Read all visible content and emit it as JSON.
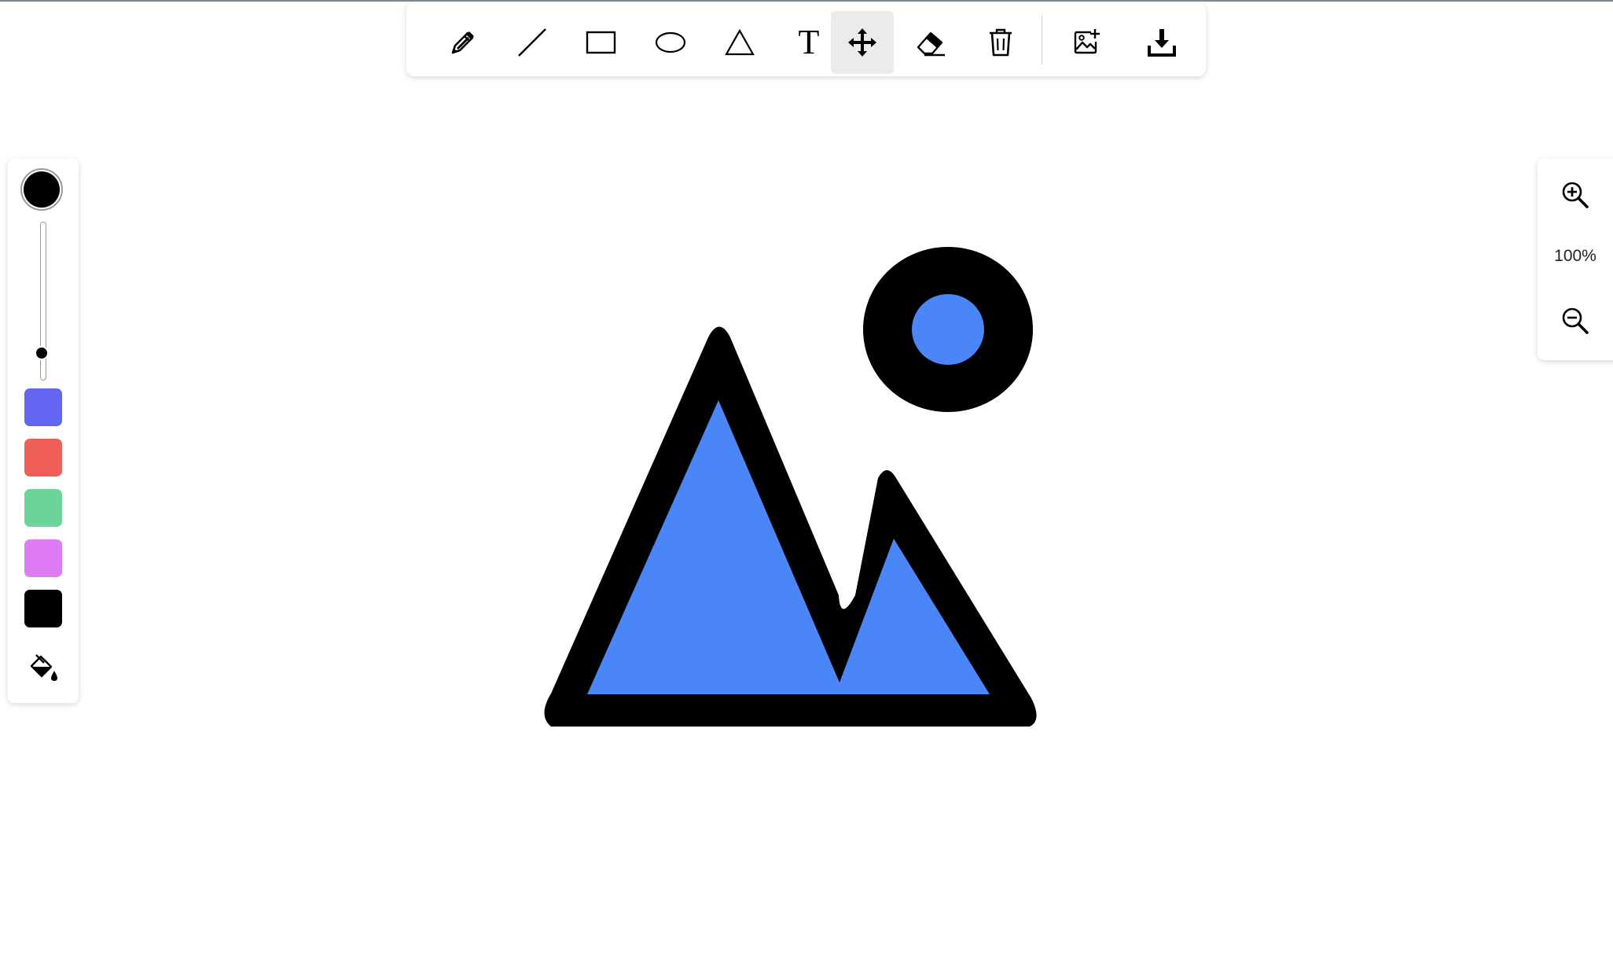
{
  "toolbar": {
    "tools": [
      {
        "id": "pencil",
        "icon": "pencil-icon",
        "active": false
      },
      {
        "id": "line",
        "icon": "line-icon",
        "active": false
      },
      {
        "id": "rectangle",
        "icon": "rectangle-icon",
        "active": false
      },
      {
        "id": "ellipse",
        "icon": "ellipse-icon",
        "active": false
      },
      {
        "id": "triangle",
        "icon": "triangle-icon",
        "active": false
      },
      {
        "id": "text",
        "icon": "text-icon",
        "label": "T",
        "active": false
      },
      {
        "id": "move",
        "icon": "move-icon",
        "active": true
      },
      {
        "id": "eraser",
        "icon": "eraser-icon",
        "active": false
      },
      {
        "id": "delete",
        "icon": "trash-icon",
        "active": false
      },
      {
        "id": "add-image",
        "icon": "add-image-icon",
        "active": false
      },
      {
        "id": "download",
        "icon": "download-icon",
        "active": false
      }
    ]
  },
  "palette": {
    "current_color": "#000000",
    "stroke_size_level": 0.85,
    "swatches": [
      "#6366f1",
      "#ef5f57",
      "#6bd49a",
      "#df7bf5",
      "#000000"
    ],
    "fill_tool_icon": "paint-bucket-icon"
  },
  "zoom": {
    "level": "100%",
    "zoom_in_icon": "zoom-in-icon",
    "zoom_out_icon": "zoom-out-icon"
  },
  "drawing": {
    "stroke_color": "#000000",
    "fill_color": "#4a86f7",
    "shapes": [
      "mountain",
      "sun"
    ]
  }
}
